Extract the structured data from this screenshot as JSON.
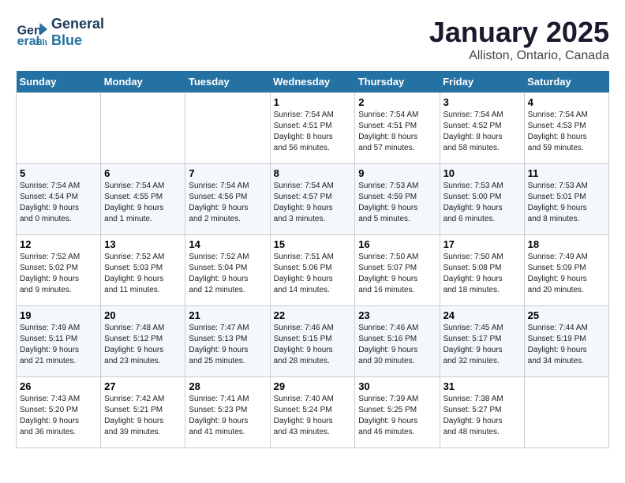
{
  "header": {
    "logo_line1": "General",
    "logo_line2": "Blue",
    "month_title": "January 2025",
    "location": "Alliston, Ontario, Canada"
  },
  "days_of_week": [
    "Sunday",
    "Monday",
    "Tuesday",
    "Wednesday",
    "Thursday",
    "Friday",
    "Saturday"
  ],
  "weeks": [
    [
      {
        "day": "",
        "info": ""
      },
      {
        "day": "",
        "info": ""
      },
      {
        "day": "",
        "info": ""
      },
      {
        "day": "1",
        "info": "Sunrise: 7:54 AM\nSunset: 4:51 PM\nDaylight: 8 hours\nand 56 minutes."
      },
      {
        "day": "2",
        "info": "Sunrise: 7:54 AM\nSunset: 4:51 PM\nDaylight: 8 hours\nand 57 minutes."
      },
      {
        "day": "3",
        "info": "Sunrise: 7:54 AM\nSunset: 4:52 PM\nDaylight: 8 hours\nand 58 minutes."
      },
      {
        "day": "4",
        "info": "Sunrise: 7:54 AM\nSunset: 4:53 PM\nDaylight: 8 hours\nand 59 minutes."
      }
    ],
    [
      {
        "day": "5",
        "info": "Sunrise: 7:54 AM\nSunset: 4:54 PM\nDaylight: 9 hours\nand 0 minutes."
      },
      {
        "day": "6",
        "info": "Sunrise: 7:54 AM\nSunset: 4:55 PM\nDaylight: 9 hours\nand 1 minute."
      },
      {
        "day": "7",
        "info": "Sunrise: 7:54 AM\nSunset: 4:56 PM\nDaylight: 9 hours\nand 2 minutes."
      },
      {
        "day": "8",
        "info": "Sunrise: 7:54 AM\nSunset: 4:57 PM\nDaylight: 9 hours\nand 3 minutes."
      },
      {
        "day": "9",
        "info": "Sunrise: 7:53 AM\nSunset: 4:59 PM\nDaylight: 9 hours\nand 5 minutes."
      },
      {
        "day": "10",
        "info": "Sunrise: 7:53 AM\nSunset: 5:00 PM\nDaylight: 9 hours\nand 6 minutes."
      },
      {
        "day": "11",
        "info": "Sunrise: 7:53 AM\nSunset: 5:01 PM\nDaylight: 9 hours\nand 8 minutes."
      }
    ],
    [
      {
        "day": "12",
        "info": "Sunrise: 7:52 AM\nSunset: 5:02 PM\nDaylight: 9 hours\nand 9 minutes."
      },
      {
        "day": "13",
        "info": "Sunrise: 7:52 AM\nSunset: 5:03 PM\nDaylight: 9 hours\nand 11 minutes."
      },
      {
        "day": "14",
        "info": "Sunrise: 7:52 AM\nSunset: 5:04 PM\nDaylight: 9 hours\nand 12 minutes."
      },
      {
        "day": "15",
        "info": "Sunrise: 7:51 AM\nSunset: 5:06 PM\nDaylight: 9 hours\nand 14 minutes."
      },
      {
        "day": "16",
        "info": "Sunrise: 7:50 AM\nSunset: 5:07 PM\nDaylight: 9 hours\nand 16 minutes."
      },
      {
        "day": "17",
        "info": "Sunrise: 7:50 AM\nSunset: 5:08 PM\nDaylight: 9 hours\nand 18 minutes."
      },
      {
        "day": "18",
        "info": "Sunrise: 7:49 AM\nSunset: 5:09 PM\nDaylight: 9 hours\nand 20 minutes."
      }
    ],
    [
      {
        "day": "19",
        "info": "Sunrise: 7:49 AM\nSunset: 5:11 PM\nDaylight: 9 hours\nand 21 minutes."
      },
      {
        "day": "20",
        "info": "Sunrise: 7:48 AM\nSunset: 5:12 PM\nDaylight: 9 hours\nand 23 minutes."
      },
      {
        "day": "21",
        "info": "Sunrise: 7:47 AM\nSunset: 5:13 PM\nDaylight: 9 hours\nand 25 minutes."
      },
      {
        "day": "22",
        "info": "Sunrise: 7:46 AM\nSunset: 5:15 PM\nDaylight: 9 hours\nand 28 minutes."
      },
      {
        "day": "23",
        "info": "Sunrise: 7:46 AM\nSunset: 5:16 PM\nDaylight: 9 hours\nand 30 minutes."
      },
      {
        "day": "24",
        "info": "Sunrise: 7:45 AM\nSunset: 5:17 PM\nDaylight: 9 hours\nand 32 minutes."
      },
      {
        "day": "25",
        "info": "Sunrise: 7:44 AM\nSunset: 5:19 PM\nDaylight: 9 hours\nand 34 minutes."
      }
    ],
    [
      {
        "day": "26",
        "info": "Sunrise: 7:43 AM\nSunset: 5:20 PM\nDaylight: 9 hours\nand 36 minutes."
      },
      {
        "day": "27",
        "info": "Sunrise: 7:42 AM\nSunset: 5:21 PM\nDaylight: 9 hours\nand 39 minutes."
      },
      {
        "day": "28",
        "info": "Sunrise: 7:41 AM\nSunset: 5:23 PM\nDaylight: 9 hours\nand 41 minutes."
      },
      {
        "day": "29",
        "info": "Sunrise: 7:40 AM\nSunset: 5:24 PM\nDaylight: 9 hours\nand 43 minutes."
      },
      {
        "day": "30",
        "info": "Sunrise: 7:39 AM\nSunset: 5:25 PM\nDaylight: 9 hours\nand 46 minutes."
      },
      {
        "day": "31",
        "info": "Sunrise: 7:38 AM\nSunset: 5:27 PM\nDaylight: 9 hours\nand 48 minutes."
      },
      {
        "day": "",
        "info": ""
      }
    ]
  ]
}
